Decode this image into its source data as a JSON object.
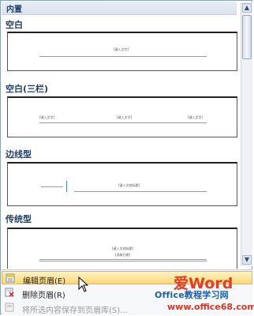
{
  "gallery": {
    "header": "内置",
    "sections": [
      {
        "label": "空白",
        "tiny": [
          "[键入文字]"
        ]
      },
      {
        "label": "空白(三栏)",
        "tiny": [
          "[键入文字]",
          "[键入文字]",
          "[键入文字]"
        ]
      },
      {
        "label": "边线型",
        "tiny": [
          "[键入文档标题]"
        ]
      },
      {
        "label": "传统型",
        "tiny": [
          "[键入文档标题]",
          "[选取日期]"
        ]
      }
    ]
  },
  "scrollbar": {
    "up": "▲",
    "down": "▼"
  },
  "menu": {
    "items": [
      {
        "label": "编辑页眉(E)",
        "icon": "edit-header-icon",
        "enabled": true,
        "highlighted": true
      },
      {
        "label": "删除页眉(R)",
        "icon": "delete-header-icon",
        "enabled": true,
        "highlighted": false
      },
      {
        "label": "将所选内容保存到页眉库(S)...",
        "icon": "save-selection-icon",
        "enabled": false,
        "highlighted": false
      }
    ]
  },
  "watermark": {
    "line1": "爱Word",
    "line2": "Office教程学习网",
    "line3": "www.office68.com"
  },
  "colors": {
    "accent": "#1f3f68",
    "highlight": "#ffd877",
    "watermark_red": "#e0402a",
    "watermark_blue": "#1a60b0"
  }
}
